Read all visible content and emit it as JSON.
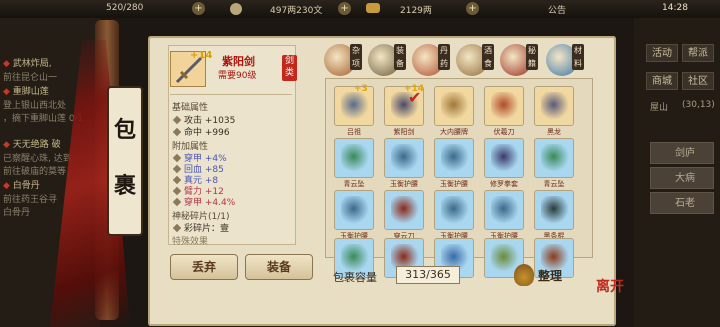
{
  "topbar": {
    "stamina": "520/280",
    "silver": "497两230文",
    "ingot": "2129两",
    "announce": "公告",
    "clock": "14:28"
  },
  "quests": [
    {
      "title": "武林炸局,",
      "desc": "前往昆仑山一"
    },
    {
      "title": "重脚山莲",
      "desc": "登上银山西北处"
    },
    {
      "title": "",
      "desc": "，摘下重脚山莲 0/1"
    },
    {
      "title": "天无绝路 破",
      "desc": "已察醒心珠, 达到"
    },
    {
      "title": "",
      "desc": "前往破庙的莫等"
    },
    {
      "title": "白骨丹",
      "desc": "前往药王谷寻"
    },
    {
      "title": "",
      "desc": "白骨丹"
    }
  ],
  "right_panel": {
    "buttons": [
      "活动",
      "帮派",
      "商城",
      "社区"
    ],
    "location": "屋山",
    "location_coord": "(30,13)",
    "tabs": [
      "剑庐",
      "大病",
      "石老"
    ]
  },
  "bag_title": [
    "包",
    "裹"
  ],
  "selected_item": {
    "name": "紫阳剑",
    "enhance": "+14",
    "requirement": "需要90级",
    "seal": "剑类",
    "base_title": "基础属性",
    "base_attrs": [
      {
        "label": "攻击",
        "value": "+1035"
      },
      {
        "label": "命中",
        "value": "+996"
      }
    ],
    "add_title": "附加属性",
    "add_attrs": [
      {
        "label": "穿甲",
        "value": "+4%"
      },
      {
        "label": "回血",
        "value": "+85"
      },
      {
        "label": "真元",
        "value": "+8"
      },
      {
        "label": "臂力",
        "value": "+12"
      },
      {
        "label": "穿甲",
        "value": "+4.4%"
      }
    ],
    "shard_title": "神秘碎片(1/1)",
    "shard_line": "彩碎片：壹",
    "special_title": "特殊效果"
  },
  "buttons": {
    "discard": "丢弃",
    "equip": "装备",
    "sort": "整理"
  },
  "categories": [
    {
      "label": "杂项",
      "color": "#a35a28"
    },
    {
      "label": "装备",
      "color": "#6b5a3a"
    },
    {
      "label": "丹药",
      "color": "#b04a2a"
    },
    {
      "label": "酒食",
      "color": "#8f6a3a"
    },
    {
      "label": "秘籍",
      "color": "#9a2a1e"
    },
    {
      "label": "材料",
      "color": "#3a74a8"
    }
  ],
  "grid": [
    {
      "name": "吕祖",
      "badge": "+3",
      "bg": "#f1d8a0",
      "color": "#5a6a8a"
    },
    {
      "name": "紫阳剑",
      "badge": "+14",
      "check": true,
      "bg": "#f1d8a0",
      "color": "#4a4a6a"
    },
    {
      "name": "大内腰牌",
      "bg": "#f1d8a0",
      "color": "#a0783a"
    },
    {
      "name": "伏羲刀",
      "bg": "#f1d8a0",
      "color": "#b04a2a"
    },
    {
      "name": "黑龙",
      "bg": "#f1d8a0",
      "color": "#5a5a7a"
    },
    {
      "name": "青云坠",
      "bg": "#a9d7f0",
      "color": "#3a8a5a"
    },
    {
      "name": "玉衡护腰",
      "bg": "#a9d7f0",
      "color": "#3a6a8a"
    },
    {
      "name": "玉衡护腰",
      "bg": "#a9d7f0",
      "color": "#3a6a8a"
    },
    {
      "name": "修罗拳套",
      "bg": "#a9d7f0",
      "color": "#3a3a6a"
    },
    {
      "name": "青云坠",
      "bg": "#a9d7f0",
      "color": "#3a8a5a"
    },
    {
      "name": "玉衡护腰",
      "bg": "#a9d7f0",
      "color": "#3a6a8a"
    },
    {
      "name": "穿云刀",
      "bg": "#a9d7f0",
      "color": "#8a2a1a"
    },
    {
      "name": "玉衡护腰",
      "bg": "#a9d7f0",
      "color": "#3a6a8a"
    },
    {
      "name": "玉衡护腰",
      "bg": "#a9d7f0",
      "color": "#3a6a8a"
    },
    {
      "name": "黑条棍",
      "bg": "#a9d7f0",
      "color": "#2a3a3a"
    },
    {
      "name": "",
      "bg": "#a9d7f0",
      "color": "#3a8a5a"
    },
    {
      "name": "",
      "bg": "#a9d7f0",
      "color": "#8a2a1a"
    },
    {
      "name": "",
      "bg": "#a9d7f0",
      "color": "#3a6aa8"
    },
    {
      "name": "",
      "bg": "#a9d7f0",
      "color": "#6a8a3a"
    },
    {
      "name": "",
      "bg": "#a9d7f0",
      "color": "#8a3a1a"
    }
  ],
  "capacity": {
    "label": "包裹容量",
    "value": "313/365"
  },
  "logo": "离开"
}
